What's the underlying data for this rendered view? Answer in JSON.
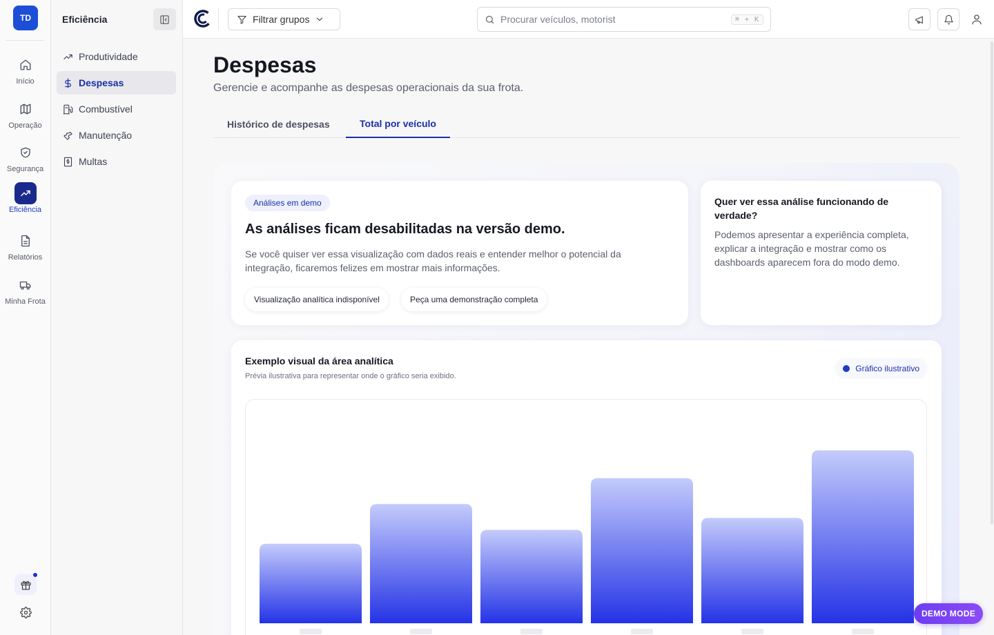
{
  "rail": {
    "avatar_initials": "TD",
    "items": [
      {
        "label": "Início",
        "icon": "home-icon"
      },
      {
        "label": "Operação",
        "icon": "map-icon"
      },
      {
        "label": "Segurança",
        "icon": "shield-icon"
      },
      {
        "label": "Eficiência",
        "icon": "trending-up-icon",
        "active": true
      },
      {
        "label": "Relatórios",
        "icon": "file-icon"
      },
      {
        "label": "Minha Frota",
        "icon": "truck-icon"
      }
    ]
  },
  "subnav": {
    "title": "Eficiência",
    "items": [
      {
        "label": "Produtividade",
        "icon": "trending-up-icon"
      },
      {
        "label": "Despesas",
        "icon": "dollar-icon",
        "active": true
      },
      {
        "label": "Combustível",
        "icon": "fuel-icon"
      },
      {
        "label": "Manutenção",
        "icon": "wrench-icon"
      },
      {
        "label": "Multas",
        "icon": "receipt-icon"
      }
    ]
  },
  "topbar": {
    "filter_label": "Filtrar grupos",
    "search_placeholder": "Procurar veículos, motorist",
    "search_shortcut": "⌘ + K"
  },
  "page": {
    "title": "Despesas",
    "subtitle": "Gerencie e acompanhe as despesas operacionais da sua frota.",
    "tabs": [
      {
        "label": "Histórico de despesas"
      },
      {
        "label": "Total por veículo",
        "active": true
      }
    ]
  },
  "demo_card": {
    "pill": "Análises em demo",
    "title": "As análises ficam desabilitadas na versão demo.",
    "text": "Se você quiser ver essa visualização com dados reais e entender melhor o potencial da integração, ficaremos felizes em mostrar mais informações.",
    "chip_1": "Visualização analítica indisponível",
    "chip_2": "Peça uma demonstração completa"
  },
  "cta_card": {
    "title": "Quer ver essa análise funcionando de verdade?",
    "text": "Podemos apresentar a experiência completa, explicar a integração e mostrar como os dashboards aparecem fora do modo demo."
  },
  "chart_card": {
    "title": "Exemplo visual da área analítica",
    "subtitle": "Prévia ilustrativa para representar onde o gráfico seria exibido.",
    "badge": "Gráfico ilustrativo"
  },
  "chart_data": {
    "type": "bar",
    "categories": [
      "",
      "",
      "",
      "",
      "",
      ""
    ],
    "values": [
      40,
      60,
      47,
      73,
      53,
      87
    ],
    "ylim": [
      0,
      100
    ],
    "grid": false,
    "colors": {
      "top": "#c4cbfb",
      "bottom": "#2433e6"
    }
  },
  "demo_mode_label": "DEMO MODE",
  "colors": {
    "accent": "#1a2fa8",
    "active_rail": "#1a2a8c",
    "avatar": "#1d4ed8"
  }
}
